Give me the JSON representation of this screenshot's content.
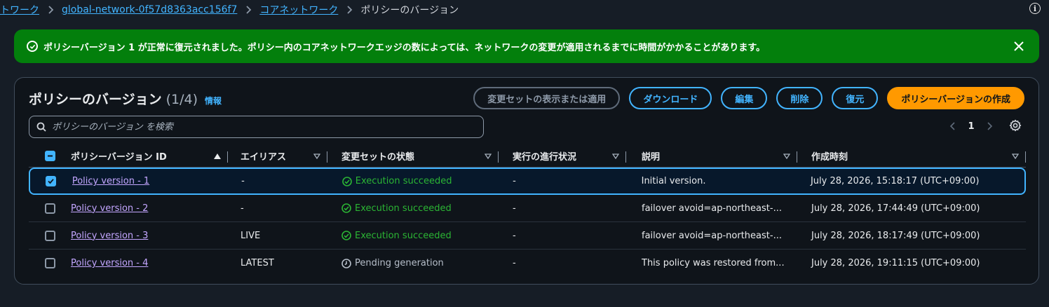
{
  "breadcrumb": {
    "items": [
      "トワーク",
      "global-network-0f57d8363acc156f7",
      "コアネットワーク"
    ],
    "current": "ポリシーのバージョン"
  },
  "info_corner": "i",
  "flash": {
    "message": "ポリシーバージョン 1 が正常に復元されました。ポリシー内のコアネットワークエッジの数によっては、ネットワークの変更が適用されるまでに時間がかかることがあります。",
    "type": "success"
  },
  "panel": {
    "title": "ポリシーのバージョン",
    "count": "(1/4)",
    "info_link": "情報"
  },
  "actions": {
    "view_apply": "変更セットの表示または適用",
    "download": "ダウンロード",
    "edit": "編集",
    "delete": "削除",
    "restore": "復元",
    "create": "ポリシーバージョンの作成"
  },
  "search": {
    "placeholder": "ポリシーのバージョン を検索"
  },
  "pagination": {
    "current_page": "1"
  },
  "table": {
    "columns": [
      "ポリシーバージョン ID",
      "エイリアス",
      "変更セットの状態",
      "実行の進行状況",
      "説明",
      "作成時刻"
    ],
    "rows": [
      {
        "id": "Policy version - 1",
        "alias": "-",
        "status": "Execution succeeded",
        "status_type": "success",
        "progress": "-",
        "description": "Initial version.",
        "created": "July 28, 2026, 15:18:17 (UTC+09:00)",
        "selected": true
      },
      {
        "id": "Policy version - 2",
        "alias": "-",
        "status": "Execution succeeded",
        "status_type": "success",
        "progress": "-",
        "description": "failover avoid=ap-northeast-...",
        "created": "July 28, 2026, 17:44:49 (UTC+09:00)",
        "selected": false
      },
      {
        "id": "Policy version - 3",
        "alias": "LIVE",
        "status": "Execution succeeded",
        "status_type": "success",
        "progress": "-",
        "description": "failover avoid=ap-northeast-...",
        "created": "July 28, 2026, 18:17:49 (UTC+09:00)",
        "selected": false
      },
      {
        "id": "Policy version - 4",
        "alias": "LATEST",
        "status": "Pending generation",
        "status_type": "pending",
        "progress": "-",
        "description": "This policy was restored from...",
        "created": "July 28, 2026, 19:11:15 (UTC+09:00)",
        "selected": false
      }
    ]
  },
  "colors": {
    "success_banner": "#037f0c",
    "link": "#42b4ff",
    "visited_link": "#c3a6ff",
    "primary_button": "#ff9900",
    "success_text": "#2bb534"
  }
}
